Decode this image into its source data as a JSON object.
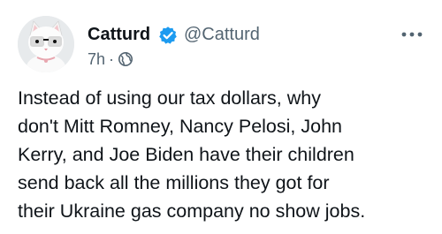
{
  "post": {
    "author": {
      "display_name": "Catturd",
      "handle": "@Catturd",
      "verified": true,
      "avatar_icon": "cat-with-glasses-avatar"
    },
    "timestamp": "7h",
    "separator": "·",
    "audience_icon": "globe-icon",
    "more_icon": "more-options-icon",
    "text_lines": [
      "Instead of using our tax dollars, why",
      "don't Mitt Romney, Nancy Pelosi, John",
      "Kerry, and Joe Biden have their children",
      "send back all the millions they got for",
      "their Ukraine gas company no show jobs."
    ]
  },
  "colors": {
    "text_primary": "#0f1419",
    "text_secondary": "#536471",
    "verified_blue": "#1d9bf0",
    "background": "#ffffff"
  }
}
